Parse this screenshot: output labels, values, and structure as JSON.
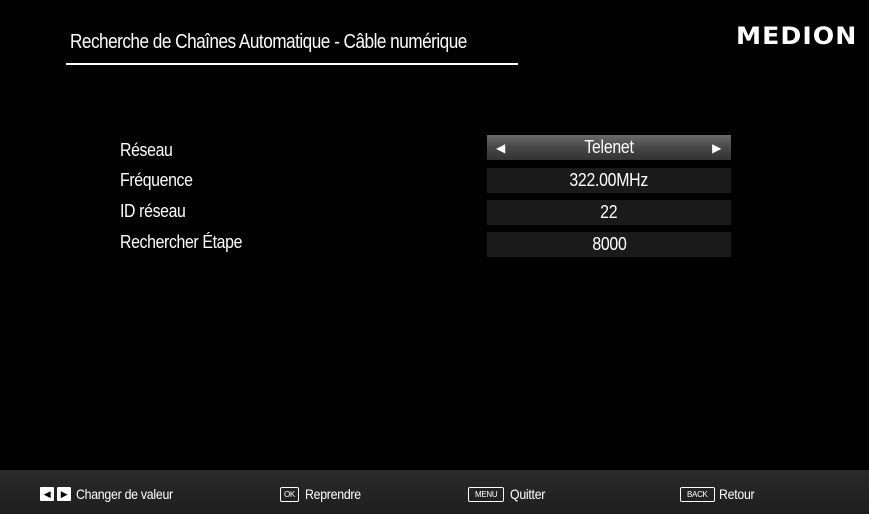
{
  "header": {
    "title": "Recherche de Chaînes Automatique - Câble numérique",
    "brand": "MEDION"
  },
  "settings": [
    {
      "label": "Réseau",
      "value": "Telenet",
      "selected": true
    },
    {
      "label": "Fréquence",
      "value": "322.00MHz"
    },
    {
      "label": "ID réseau",
      "value": "22"
    },
    {
      "label": "Rechercher Étape",
      "value": "8000"
    }
  ],
  "footer": {
    "change_value": {
      "text": "Changer de valeur",
      "icons": [
        "left-arrow-key-icon",
        "right-arrow-key-icon"
      ]
    },
    "resume": {
      "key": "OK",
      "text": "Reprendre"
    },
    "quit": {
      "key": "MENU",
      "text": "Quitter"
    },
    "back": {
      "key": "BACK",
      "text": "Retour"
    }
  },
  "colors": {
    "background": "#000000",
    "text": "#ffffff",
    "value_box": "#1a1a1a",
    "selected_box": "#474747"
  }
}
